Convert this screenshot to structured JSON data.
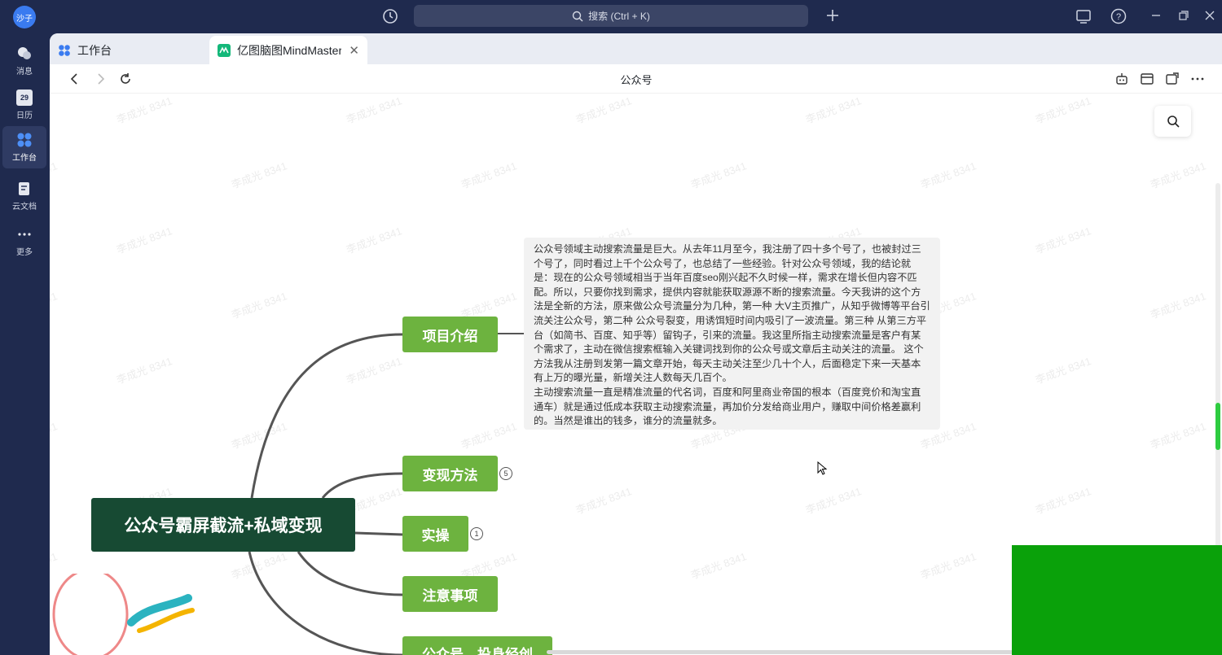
{
  "titlebar": {
    "avatar_text": "沙子",
    "search_placeholder": "搜索 (Ctrl + K)"
  },
  "rail": {
    "items": [
      {
        "label": "消息",
        "icon": "chat-icon"
      },
      {
        "label": "日历",
        "icon": "calendar-icon",
        "day": "29"
      },
      {
        "label": "工作台",
        "icon": "workspace-icon",
        "active": true
      },
      {
        "label": "云文档",
        "icon": "cloud-doc-icon"
      },
      {
        "label": "更多",
        "icon": "more-icon"
      }
    ]
  },
  "tabs": [
    {
      "label": "工作台",
      "icon": "workspace-icon"
    },
    {
      "label": "亿图脑图MindMaster",
      "icon": "mindmaster-icon",
      "active": true
    }
  ],
  "navbar": {
    "title": "公众号"
  },
  "mindmap": {
    "root": "公众号霸屏截流+私域变现",
    "branches": [
      {
        "label": "项目介绍"
      },
      {
        "label": "变现方法",
        "badge": "5"
      },
      {
        "label": "实操",
        "badge": "1"
      },
      {
        "label": "注意事项"
      },
      {
        "label": "公众号，投身经创"
      }
    ],
    "note_lines": [
      "公众号领域主动搜索流量是巨大。从去年11月至今，我注册了四十多个号了，也被封过三个号了，同时看过上千个公众号了，也总结了一些经验。针对公众号领域，我的结论就是：现在的公众号领域相当于当年百度seo刚兴起不久时候一样，需求在增长但内容不匹配。所以，只要你找到需求，提供内容就能获取源源不断的搜索流量。今天我讲的这个方法是全新的方法，原来做公众号流量分为几种，第一种 大V主页推广，从知乎微博等平台引流关注公众号，第二种  公众号裂变，用诱饵短时间内吸引了一波流量。第三种 从第三方平台（如简书、百度、知乎等）留钩子，引来的流量。我这里所指主动搜索流量是客户有某个需求了，主动在微信搜索框输入关键词找到你的公众号或文章后主动关注的流量。 这个方法我从注册到发第一篇文章开始，每天主动关注至少几十个人，后面稳定下来一天基本有上万的曝光量，新增关注人数每天几百个。",
      "主动搜索流量一直是精准流量的代名词，百度和阿里商业帝国的根本（百度竞价和淘宝直通车）就是通过低成本获取主动搜索流量，再加价分发给商业用户，赚取中间价格差赢利的。当然是谁出的钱多，谁分的流量就多。"
    ]
  },
  "watermark": "李成光 8341",
  "colors": {
    "chrome": "#1f2a4e",
    "root_node": "#174a33",
    "branch_node": "#6db33f",
    "accent_scroll": "#2ecc40",
    "overlay_green": "#0aa10a"
  }
}
